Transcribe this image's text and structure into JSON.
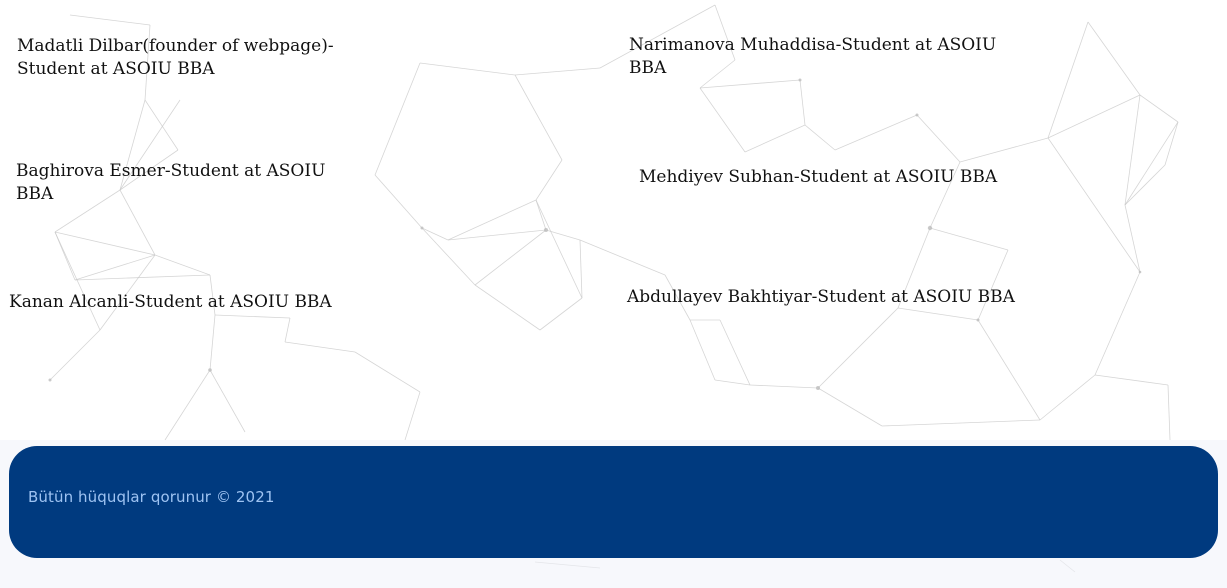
{
  "credits": [
    {
      "text": "Madatli Dilbar(founder of webpage)-Student at ASOIU BBA"
    },
    {
      "text": "Baghirova Esmer-Student at ASOIU BBA"
    },
    {
      "text": "Kanan Alcanli-Student at ASOIU BBA"
    },
    {
      "text": "Narimanova Muhaddisa-Student at ASOIU BBA"
    },
    {
      "text": "Mehdiyev Subhan-Student at ASOIU BBA"
    },
    {
      "text": "Abdullayev Bakhtiyar-Student at ASOIU BBA"
    }
  ],
  "footer": {
    "copyright": "Bütün hüquqlar qorunur © 2021",
    "background_color": "#003a7f",
    "text_color": "#9ec3f2"
  },
  "background": {
    "pattern": "network-lines-pattern",
    "line_color": "#c8c8c8"
  }
}
